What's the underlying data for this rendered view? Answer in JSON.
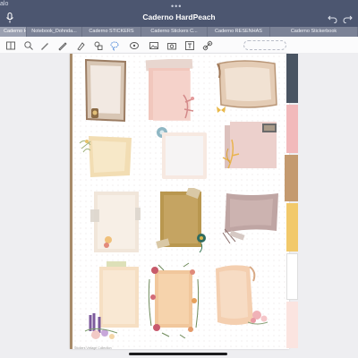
{
  "status": {
    "app_label": "alo",
    "handle_dots": "•••"
  },
  "header": {
    "title": "Caderno HardPeach"
  },
  "tabs": [
    {
      "label": "Caderno HardPeach",
      "active": true
    },
    {
      "label": "Notebook_Dohnda..."
    },
    {
      "label": "Caderno STICKERS"
    },
    {
      "label": "Caderno Stickers C..."
    },
    {
      "label": "Caderno RESENHAS"
    },
    {
      "label": "Caderno Stickerbook"
    }
  ],
  "toolbar": {
    "tools": [
      "pages-icon",
      "pen-icon",
      "highlighter-icon",
      "eraser-icon",
      "shapes-icon",
      "lasso-icon",
      "sticker-icon",
      "image-icon",
      "camera-icon",
      "text-icon",
      "link-icon"
    ]
  },
  "page": {
    "footer_text": "Stickers Vintage Collection"
  },
  "colors": {
    "header": "#4c5670",
    "tabbar": "#7b8296",
    "divider_tabs": [
      "#495462",
      "#f2b9bb",
      "#c49a6f",
      "#f2c96a",
      "#ffffff",
      "#fbe4e0"
    ]
  }
}
